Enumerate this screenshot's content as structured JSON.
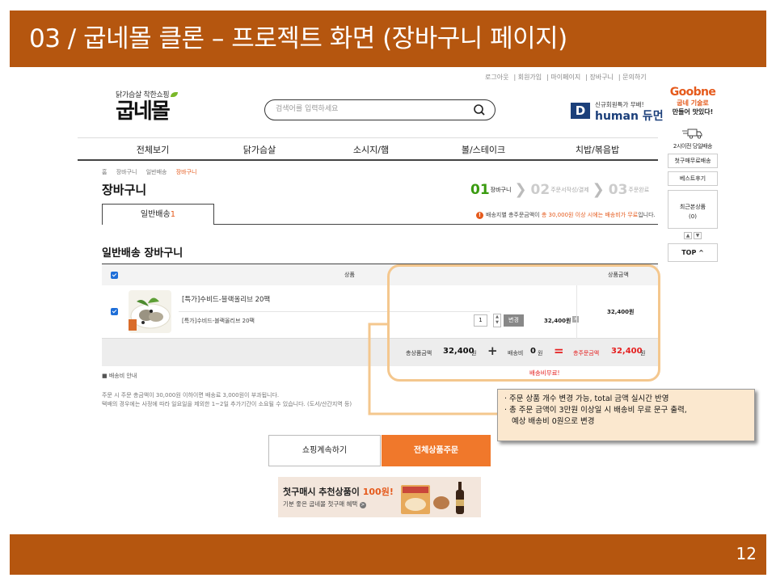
{
  "slide": {
    "title": "03 / 굽네몰 클론 – 프로젝트 화면 (장바구니 페이지)",
    "page_number": "12"
  },
  "util_links": [
    "로그아웃",
    "회원가입",
    "마이페이지",
    "장바구니",
    "문의하기"
  ],
  "logo": {
    "slogan": "닭가슴살 착한쇼핑",
    "name": "굽네몰"
  },
  "search": {
    "placeholder": "검색어를 입력하세요"
  },
  "promo": {
    "small": "신규회원특가 무배!",
    "brand": "human 듀먼",
    "icon_letter": "D"
  },
  "goobne": {
    "logo": "Goobne",
    "line1": "굽네 기술로",
    "line2": "만들어 맛있다!"
  },
  "nav": {
    "items": [
      "전체보기",
      "닭가슴살",
      "소시지/햄",
      "볼/스테이크",
      "치밥/볶음밥"
    ]
  },
  "side": {
    "delivery": "2시이전 당일배송",
    "first_free": "첫구매무료배송",
    "best": "베스트후기",
    "recent_label": "최근본상품",
    "recent_count": "(0)",
    "top": "TOP ^"
  },
  "breadcrumb": [
    "홈",
    "장바구니",
    "일반배송",
    "장바구니"
  ],
  "page_title": "장바구니",
  "steps": [
    {
      "num": "01",
      "label": "장바구니"
    },
    {
      "num": "02",
      "label": "주문서작성/결제"
    },
    {
      "num": "03",
      "label": "주문완료"
    }
  ],
  "tab": {
    "label": "일반배송",
    "count": "1"
  },
  "notice": {
    "pre": "배송지별 총주문금액이 ",
    "highlight": "총 30,000원 이상 시에는 배송비가 무료",
    "post": "입니다."
  },
  "section_title": "일반배송 장바구니",
  "table": {
    "col_product": "상품",
    "col_amount": "상품금액"
  },
  "cart_item": {
    "name": "[특가]수비드-블랙올리브 20팩",
    "option": "[특가]수비드-블랙올리브 20팩",
    "quantity": "1",
    "qty_up": "▲",
    "qty_down": "▼",
    "change_label": "변경",
    "line_price": "32,400원",
    "delete": "x",
    "amount": "32,400원"
  },
  "totals": {
    "subtotal_label": "총상품금액",
    "subtotal": "32,400",
    "won": "원",
    "plus": "+",
    "shipping_label": "배송비",
    "shipping": "0",
    "equals": "=",
    "total_label": "총주문금액",
    "total": "32,400",
    "free_label": "배송비무료!"
  },
  "shipping_info": {
    "title": "■ 배송비 안내",
    "line1": "주문 시 주문 총금액이 30,000원 이하이면 배송료 3,000원이 부과됩니다.",
    "line2": "택배의 경우에는 사정에 따라 일요일을 제외한 1~2일 추가기간이 소요될 수 있습니다. (도서/산간지역 등)"
  },
  "callout": {
    "line1": "· 주문 상품 개수 변경 가능, total 금액 실시간 반영",
    "line2": "· 총 주문 금액이 3만원 이상일 시 배송비 무료 문구 출력,",
    "line3": "예상 배송비 0원으로 변경"
  },
  "buttons": {
    "continue": "쇼핑계속하기",
    "order_all": "전체상품주문"
  },
  "banner": {
    "title_pre": "첫구매시 추천상품이 ",
    "title_accent": "100원!",
    "subtitle": "기분 좋은 굽네몰 첫구매 혜택",
    "go": ">"
  },
  "colors": {
    "header_bar": "#b5560f",
    "accent_orange": "#e55a1c",
    "order_button": "#f0782b",
    "step_active": "#3a9b10",
    "checkbox": "#1e6ed8",
    "callout_bg": "#fbe8cf",
    "highlight_border": "#f4c78e",
    "total_red": "#e52020"
  }
}
